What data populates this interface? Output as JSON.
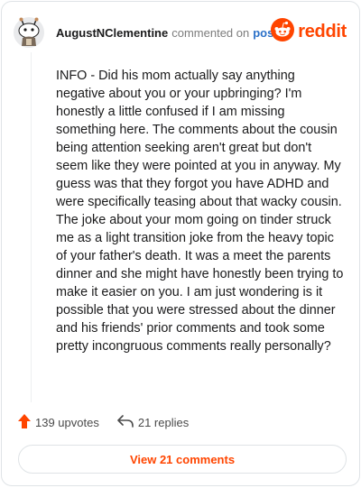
{
  "header": {
    "author": "AugustNClementine",
    "action": "commented on",
    "post_link": "post",
    "brand": "reddit",
    "avatar_icon": "snoo-avatar-icon",
    "brand_icon": "reddit-logo-icon",
    "brand_color": "#ff4500"
  },
  "comment": {
    "text": "INFO - Did his mom actually say anything negative about you or your upbringing? I'm honestly a little confused if I am missing something here. The comments about the cousin being attention seeking aren't great but don't seem like they were pointed at you in anyway. My guess was that they forgot you have ADHD and were specifically teasing about that wacky cousin. The joke about your mom going on tinder struck me as a light transition joke from the heavy topic of your father's death. It was a meet the parents dinner and she might have honestly been trying to make it easier on you. I am just wondering is it possible that you were stressed about the dinner and his friends' prior comments and took some pretty incongruous comments really personally?"
  },
  "footer": {
    "upvotes": "139 upvotes",
    "replies": "21 replies",
    "upvote_icon": "upvote-arrow-icon",
    "reply_icon": "reply-arrow-icon",
    "upvote_color": "#ff4500"
  },
  "view_button": {
    "label": "View 21 comments"
  }
}
